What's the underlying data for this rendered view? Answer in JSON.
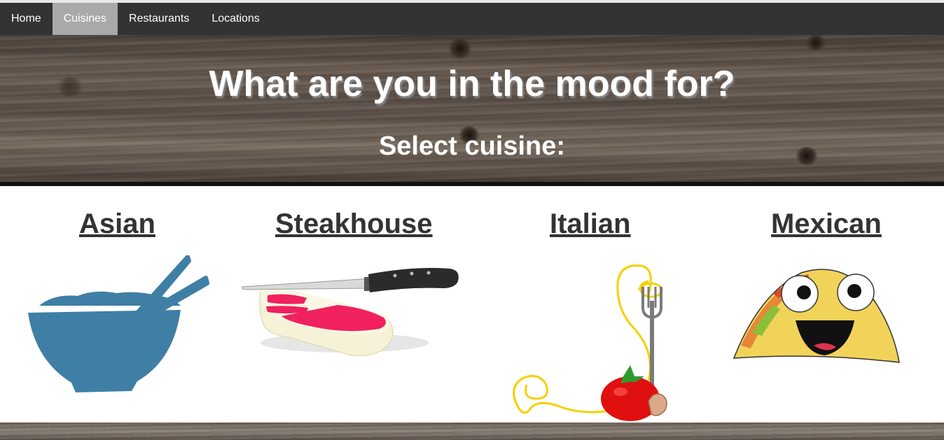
{
  "nav": {
    "items": [
      {
        "label": "Home",
        "active": false
      },
      {
        "label": "Cuisines",
        "active": true
      },
      {
        "label": "Restaurants",
        "active": false
      },
      {
        "label": "Locations",
        "active": false
      }
    ]
  },
  "hero": {
    "title": "What are you in the mood for?",
    "subtitle": "Select cuisine:"
  },
  "cuisines": [
    {
      "label": "Asian",
      "icon": "rice-bowl-chopsticks-icon"
    },
    {
      "label": "Steakhouse",
      "icon": "steak-knife-icon"
    },
    {
      "label": "Italian",
      "icon": "spaghetti-fork-tomato-icon"
    },
    {
      "label": "Mexican",
      "icon": "smiling-taco-icon"
    }
  ],
  "colors": {
    "navbar": "#333333",
    "nav_active": "#a9a9a9",
    "link_text": "#333333",
    "bowl": "#3f7fa6"
  }
}
